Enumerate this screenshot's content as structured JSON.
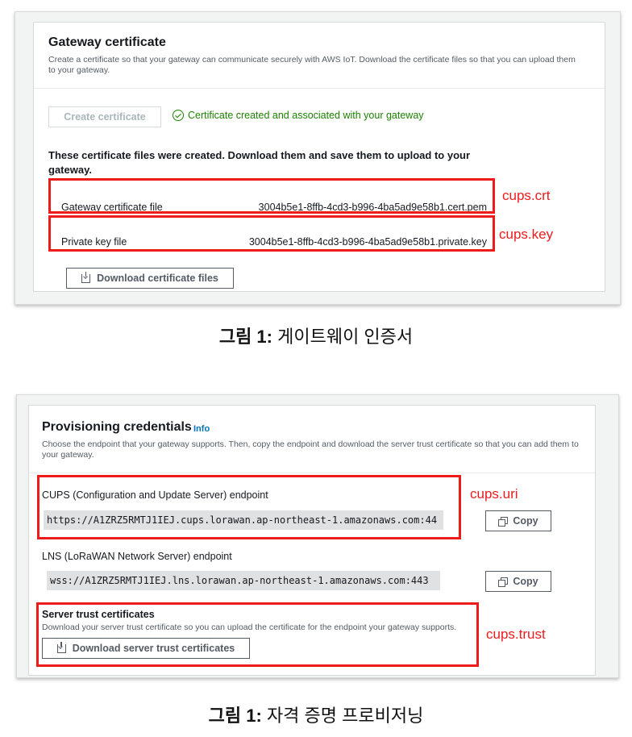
{
  "figure1": {
    "panel_title": "Gateway certificate",
    "panel_description": "Create a certificate so that your gateway can communicate securely with AWS IoT. Download the certificate files so that you can upload them to your gateway.",
    "create_button": "Create certificate",
    "success_message": "Certificate created and associated with your gateway",
    "files_heading": "These certificate files were created. Download them and save them to upload to your gateway.",
    "files": [
      {
        "label": "Gateway certificate file",
        "value": "3004b5e1-8ffb-4cd3-b996-4ba5ad9e58b1.cert.pem",
        "annotation": "cups.crt"
      },
      {
        "label": "Private key file",
        "value": "3004b5e1-8ffb-4cd3-b996-4ba5ad9e58b1.private.key",
        "annotation": "cups.key"
      }
    ],
    "download_button": "Download certificate files",
    "caption_bold": "그림 1:",
    "caption_text": " 게이트웨이 인증서"
  },
  "figure2": {
    "panel_title": "Provisioning credentials",
    "info_link": "Info",
    "panel_description": "Choose the endpoint that your gateway supports. Then, copy the endpoint and download the server trust certificate so that you can add them to your gateway.",
    "cups_label": "CUPS (Configuration and Update Server) endpoint",
    "cups_value": "https://A1ZRZ5RMTJ1IEJ.cups.lorawan.ap-northeast-1.amazonaws.com:44",
    "cups_annotation": "cups.uri",
    "lns_label": "LNS (LoRaWAN Network Server) endpoint",
    "lns_value": "wss://A1ZRZ5RMTJ1IEJ.lns.lorawan.ap-northeast-1.amazonaws.com:443",
    "copy_button": "Copy",
    "trust_title": "Server trust certificates",
    "trust_description": "Download your server trust certificate so you can upload the certificate for the endpoint your gateway supports.",
    "trust_button": "Download server trust certificates",
    "trust_annotation": "cups.trust",
    "caption_bold": "그림 1:",
    "caption_text": " 자격 증명 프로비저닝"
  },
  "colors": {
    "annotation_red": "#ee1b1b",
    "success_green": "#1d8102",
    "link_blue": "#0073bb"
  }
}
